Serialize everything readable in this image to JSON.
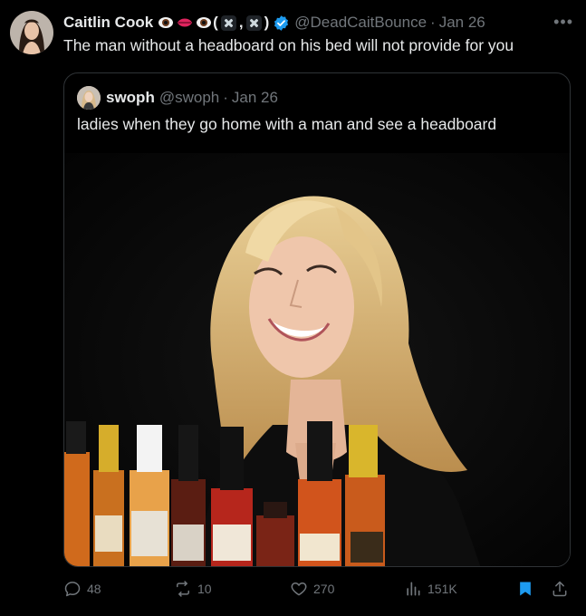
{
  "author": {
    "display_name": "Caitlin Cook",
    "emoji_suffix": "👁👄👁",
    "paren_open": "(",
    "comma": ",",
    "paren_close": ")",
    "handle": "@DeadCaitBounce",
    "separator": "·",
    "date": "Jan 26",
    "verified_color": "#1d9bf0",
    "avatar_icon": "profile-photo"
  },
  "tweet": {
    "text": "The man without a headboard on his bed will not provide for you"
  },
  "quoted": {
    "display_name": "swoph",
    "handle": "@swoph",
    "separator": "·",
    "date": "Jan 26",
    "text": "ladies when they go home with a man and see a headboard",
    "media_icon": "photo-woman-smiling-with-hot-sauce-bottles"
  },
  "actions": {
    "reply_count": "48",
    "retweet_count": "10",
    "like_count": "270",
    "view_count": "151K",
    "bookmark_color": "#1d9bf0",
    "muted_color": "#71767b"
  }
}
